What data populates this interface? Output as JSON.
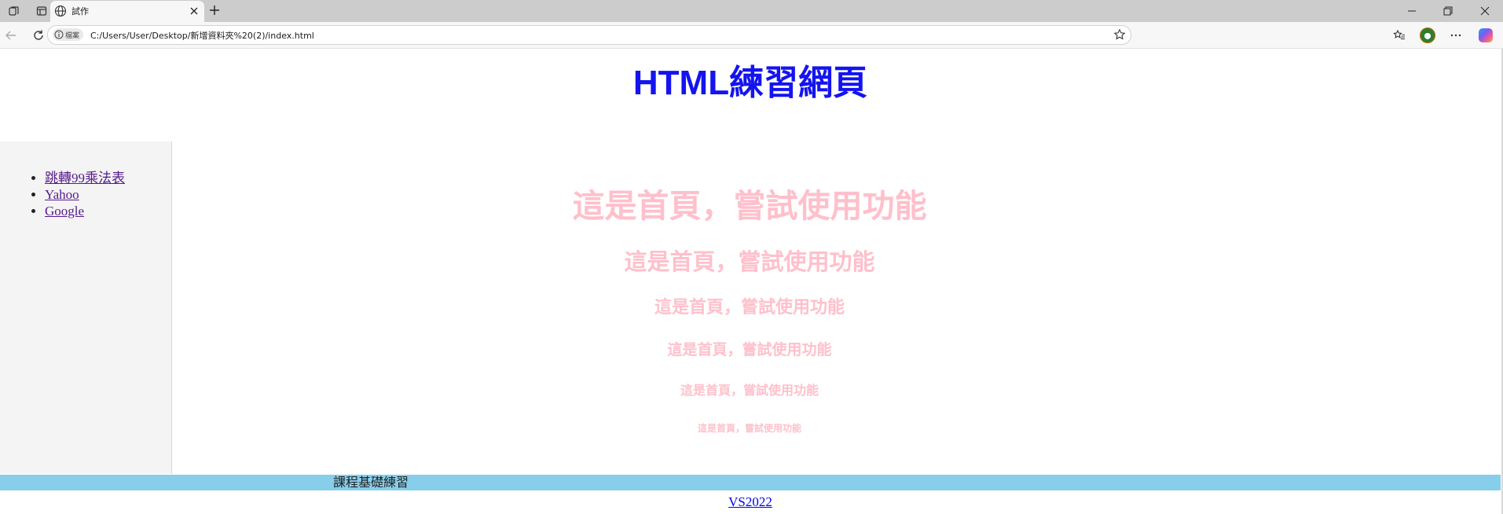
{
  "browser": {
    "tab_title": "試作",
    "address_chip_label": "檔案",
    "url": "C:/Users/User/Desktop/新增資料夾%20(2)/index.html",
    "icons": [
      "workspaces-icon",
      "tab-actions-icon",
      "globe-icon",
      "close-icon",
      "new-tab-icon",
      "back-icon",
      "refresh-icon",
      "info-icon",
      "star-icon",
      "favorites-icon",
      "profile-avatar",
      "more-icon",
      "copilot-icon",
      "minimize-icon",
      "restore-icon",
      "window-close-icon"
    ]
  },
  "page": {
    "title": "HTML練習網頁",
    "title_color": "#1414f0",
    "sidebar": {
      "links": [
        {
          "label": "跳轉99乘法表"
        },
        {
          "label": "Yahoo"
        },
        {
          "label": "Google"
        }
      ]
    },
    "main": {
      "headings": [
        "這是首頁，嘗試使用功能",
        "這是首頁，嘗試使用功能",
        "這是首頁，嘗試使用功能",
        "這是首頁，嘗試使用功能",
        "這是首頁，嘗試使用功能",
        "這是首頁，嘗試使用功能"
      ],
      "heading_color": "#ffc0cb"
    },
    "footer": {
      "text": "課程基礎練習",
      "bar_color": "#87ceeb",
      "link_label": "VS2022"
    }
  }
}
